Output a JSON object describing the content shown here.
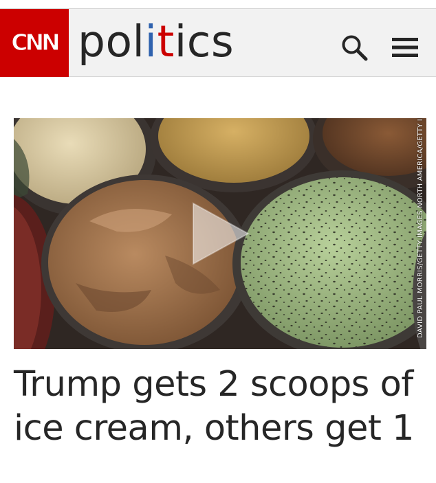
{
  "header": {
    "logo_text": "CNN",
    "section": {
      "part1": "pol",
      "part2": "i",
      "part3": "t",
      "part4": "ics"
    },
    "icons": {
      "search": "search-icon",
      "menu": "menu-icon"
    },
    "colors": {
      "brand_red": "#cc0000",
      "accent_blue": "#2f62ae",
      "header_bg": "#f2f2f2"
    }
  },
  "video": {
    "photo_credit": "DAVID PAUL MORRIS/GETTY IMAGES NORTH AMERICA/GETTY IMAGES",
    "play_icon": "play-icon"
  },
  "article": {
    "headline": "Trump gets 2 scoops of ice cream, others get 1"
  }
}
